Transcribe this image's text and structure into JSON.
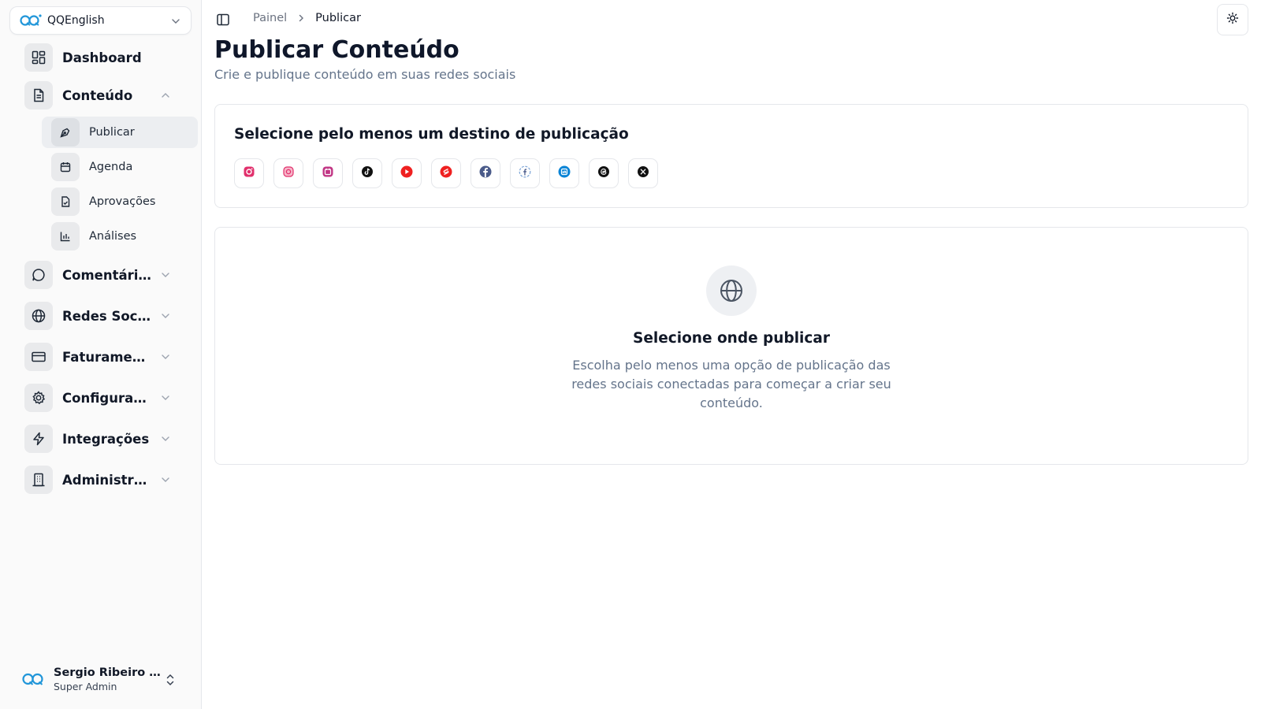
{
  "org": {
    "name": "QQEnglish"
  },
  "nav": {
    "dashboard": "Dashboard",
    "conteudo": "Conteúdo",
    "conteudo_sub": [
      "Publicar",
      "Agenda",
      "Aprovações",
      "Análises"
    ],
    "comentarios": "Comentários",
    "redes": "Redes Sociais",
    "faturamento": "Faturamento",
    "configuracoes": "Configurações",
    "integracoes": "Integrações",
    "administracao": "Administração"
  },
  "user": {
    "name": "Sergio Ribeiro Costa",
    "role": "Super Admin"
  },
  "breadcrumb": {
    "root": "Painel",
    "current": "Publicar"
  },
  "page": {
    "title": "Publicar Conteúdo",
    "subtitle": "Crie e publique conteúdo em suas redes sociais"
  },
  "destinations": {
    "heading": "Selecione pelo menos um destino de publicação",
    "platforms": [
      "instagram",
      "instagram-business",
      "instagram-stories",
      "tiktok",
      "youtube",
      "youtube-shorts",
      "facebook",
      "facebook-stories",
      "linkedin",
      "threads",
      "x"
    ]
  },
  "empty": {
    "title": "Selecione onde publicar",
    "description": "Escolha pelo menos uma opção de publicação das redes sociais conectadas para começar a criar seu conteúdo."
  },
  "colors": {
    "accent": "#111827",
    "muted": "#64748b",
    "instagram": "#e1306c",
    "youtube": "#ef2020",
    "facebook": "#4b5b8a",
    "linkedin": "#0a84d6"
  }
}
